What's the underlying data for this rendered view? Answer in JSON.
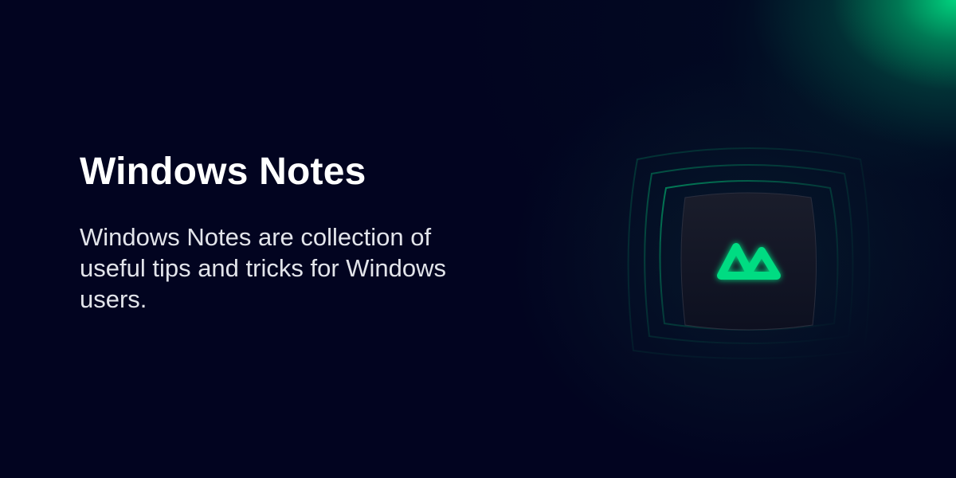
{
  "card": {
    "title": "Windows Notes",
    "description": "Windows Notes are collection of useful tips and tricks for Windows users."
  },
  "logo": {
    "icon": "nuxt-logo-icon",
    "accent_color": "#00DC82"
  },
  "colors": {
    "background": "#020420",
    "title": "#FFFFFF",
    "description": "#E2E4EA",
    "glow": "#00DC82"
  }
}
